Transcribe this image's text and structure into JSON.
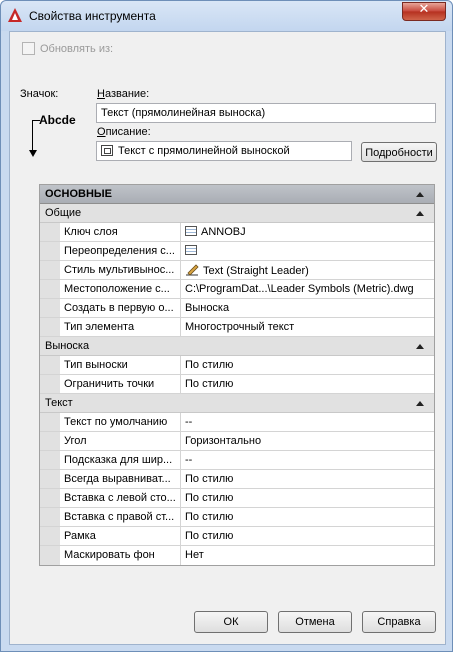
{
  "window": {
    "title": "Свойства инструмента"
  },
  "update": {
    "label": "Обновлять из:"
  },
  "icon": {
    "label": "Значок:",
    "preview_text": "Abcde"
  },
  "name": {
    "label": "Название:",
    "value": "Текст (прямолинейная выноска)"
  },
  "description": {
    "label": "Описание:",
    "value": "Текст с прямолинейной выноской"
  },
  "details_button": "Подробности",
  "grid": {
    "main_category": "ОСНОВНЫЕ",
    "sections": [
      {
        "title": "Общие",
        "rows": [
          {
            "name": "Ключ слоя",
            "value": "ANNOBJ",
            "icon": "layer-table-icon"
          },
          {
            "name": "Переопределения с...",
            "value": "",
            "icon": "layer-table-icon"
          },
          {
            "name": "Стиль мультивынос...",
            "value": "Text (Straight Leader)",
            "icon": "leader-style-icon"
          },
          {
            "name": "Местоположение с...",
            "value": "C:\\ProgramDat...\\Leader Symbols (Metric).dwg"
          },
          {
            "name": "Создать в первую о...",
            "value": "Выноска"
          },
          {
            "name": "Тип элемента",
            "value": "Многострочный текст"
          }
        ]
      },
      {
        "title": "Выноска",
        "rows": [
          {
            "name": "Тип выноски",
            "value": "По стилю"
          },
          {
            "name": "Ограничить точки",
            "value": "По стилю"
          }
        ]
      },
      {
        "title": "Текст",
        "rows": [
          {
            "name": "Текст по умолчанию",
            "value": "--"
          },
          {
            "name": "Угол",
            "value": "Горизонтально"
          },
          {
            "name": "Подсказка для шир...",
            "value": "--"
          },
          {
            "name": "Всегда выравниват...",
            "value": "По стилю"
          },
          {
            "name": "Вставка с левой сто...",
            "value": "По стилю"
          },
          {
            "name": "Вставка с правой ст...",
            "value": "По стилю"
          },
          {
            "name": "Рамка",
            "value": "По стилю"
          },
          {
            "name": "Маскировать фон",
            "value": "Нет"
          }
        ]
      }
    ]
  },
  "buttons": {
    "ok": "ОК",
    "cancel": "Отмена",
    "help": "Справка"
  }
}
